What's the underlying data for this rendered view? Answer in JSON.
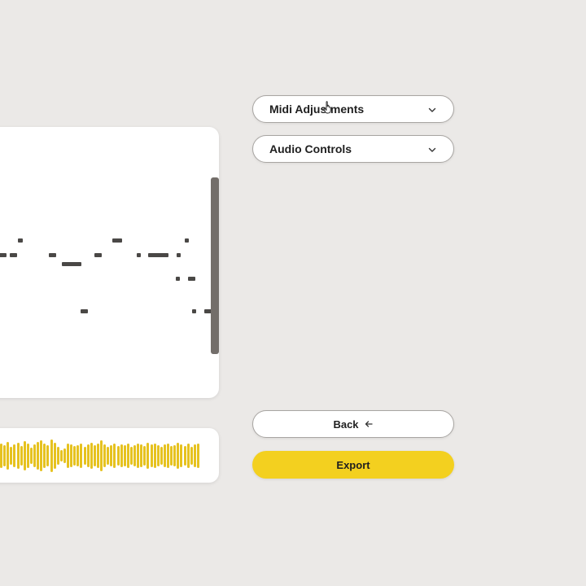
{
  "dropdowns": {
    "midi_label": "Midi Adjustments",
    "audio_label": "Audio Controls"
  },
  "buttons": {
    "back_label": "Back",
    "export_label": "Export"
  },
  "colors": {
    "background": "#ebe9e7",
    "panel": "#ffffff",
    "note": "#4a4846",
    "accent": "#f3d01f",
    "waveform": "#e6c21f",
    "scrollbar": "#736e6a"
  },
  "icons": {
    "dropdown_chevron": "chevron-down-icon",
    "back_arrow": "arrow-left-icon",
    "cursor": "hand-pointer-icon"
  }
}
